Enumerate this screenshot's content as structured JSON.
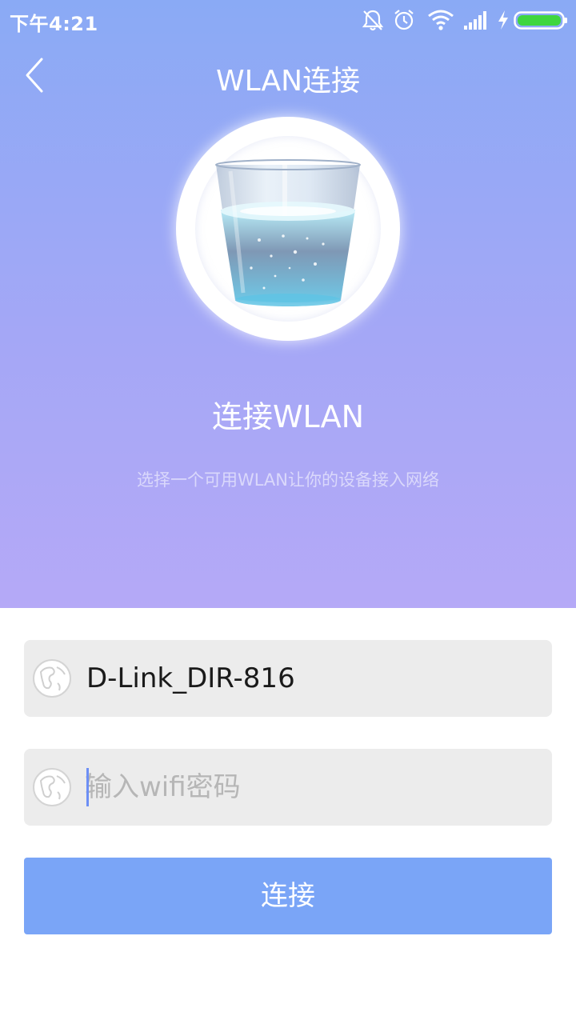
{
  "status_bar": {
    "time": "下午4:21"
  },
  "header": {
    "title": "WLAN连接"
  },
  "hero": {
    "title": "连接WLAN",
    "subtitle": "选择一个可用WLAN让你的设备接入网络"
  },
  "form": {
    "ssid_value": "D-Link_DIR-816",
    "password_placeholder": "输入wifi密码",
    "connect_label": "连接"
  },
  "colors": {
    "accent": "#7aa5f7",
    "gradient_top": "#8aaaf5",
    "gradient_bottom": "#b5a9f7",
    "field_bg": "#ececec",
    "battery": "#3fd63f"
  },
  "icons": {
    "back": "chevron-left-icon",
    "network": "globe-icon",
    "status": [
      "mute-bell-icon",
      "alarm-icon",
      "wifi-icon",
      "signal-icon",
      "charging-icon",
      "battery-icon"
    ]
  }
}
